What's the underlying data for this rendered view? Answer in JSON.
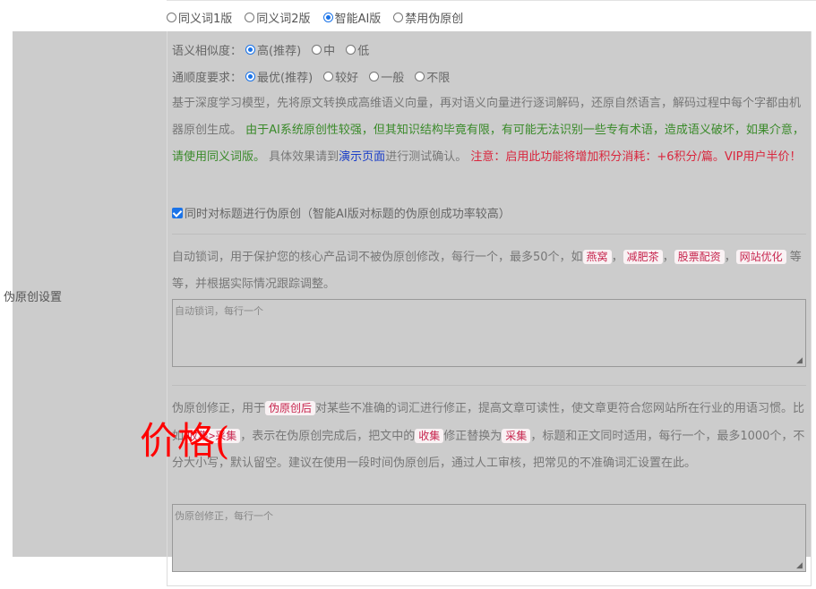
{
  "version_options": [
    {
      "label": "同义词1版",
      "selected": false
    },
    {
      "label": "同义词2版",
      "selected": false
    },
    {
      "label": "智能AI版",
      "selected": true
    },
    {
      "label": "禁用伪原创",
      "selected": false
    }
  ],
  "side_label": "伪原创设置",
  "similarity": {
    "label": "语义相似度：",
    "options": [
      {
        "label": "高(推荐)",
        "selected": true
      },
      {
        "label": "中",
        "selected": false
      },
      {
        "label": "低",
        "selected": false
      }
    ]
  },
  "fluency": {
    "label": "通顺度要求：",
    "options": [
      {
        "label": "最优(推荐)",
        "selected": true
      },
      {
        "label": "较好",
        "selected": false
      },
      {
        "label": "一般",
        "selected": false
      },
      {
        "label": "不限",
        "selected": false
      }
    ]
  },
  "description": {
    "part1": "基于深度学习模型，先将原文转换成高维语义向量，再对语义向量进行逐词解码，还原自然语言，解码过程中每个字都由机器原创生成。",
    "green": "由于AI系统原创性较强，但其知识结构毕竟有限，有可能无法识别一些专有术语，造成语义破坏，如果介意，请使用同义词版。",
    "part2": "具体效果请到",
    "link": "演示页面",
    "part3": "进行测试确认。",
    "red": "注意：启用此功能将增加积分消耗：+6积分/篇。VIP用户半价！"
  },
  "title_checkbox": {
    "label": "同时对标题进行伪原创（智能AI版对标题的伪原创成功率较高）",
    "checked": true
  },
  "lock_words": {
    "text1": "自动锁词，用于保护您的核心产品词不被伪原创修改，每行一个，最多50个，如",
    "examples": [
      "燕窝",
      "减肥茶",
      "股票配资",
      "网站优化"
    ],
    "sep": "，",
    "text2": "等等，并根据实际情况跟踪调整。",
    "placeholder": "自动锁词，每行一个"
  },
  "correction": {
    "text1": "伪原创修正，用于",
    "code1": "伪原创后",
    "text2": "对某些不准确的词汇进行修正，提高文章可读性，使文章更符合您网站所在行业的用语习惯。比如",
    "code2": "收集>采集",
    "text3": "，表示在伪原创完成后，把文中的",
    "code3": "收集",
    "text4": "修正替换为",
    "code4": "采集",
    "text5": "，标题和正文同时适用，每行一个，最多1000个，不分大小写，默认留空。建议在使用一段时间伪原创后，通过人工审核，把常见的不准确词汇设置在此。",
    "placeholder": "伪原创修正，每行一个"
  },
  "watermark": "价格("
}
